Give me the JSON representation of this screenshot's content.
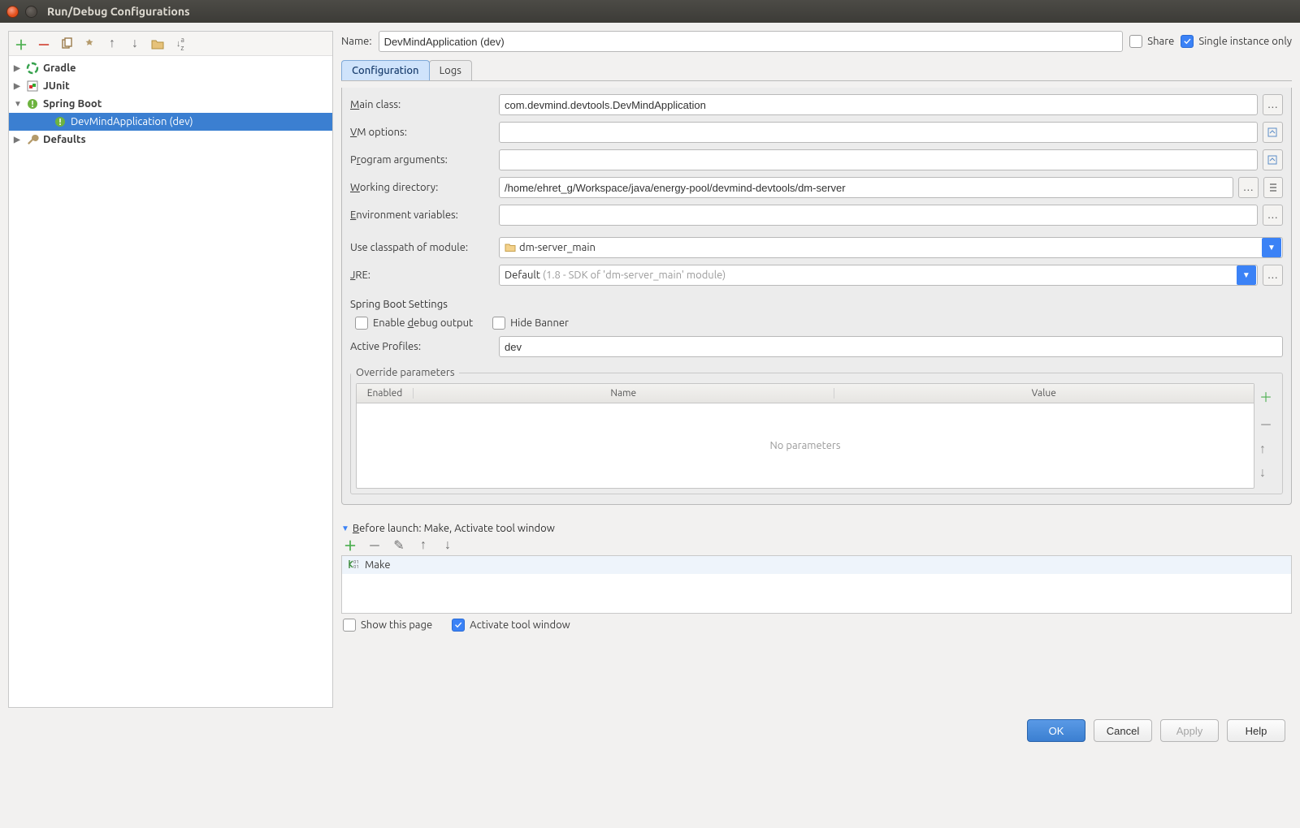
{
  "window": {
    "title": "Run/Debug Configurations"
  },
  "sidebar": {
    "toolbar": {
      "add": "+",
      "remove": "−",
      "copy": "⧉",
      "wrench": "⚙",
      "up": "↑",
      "down": "↓",
      "folder": "📁",
      "sort": "↓ᴬᶻ"
    },
    "nodes": {
      "gradle": "Gradle",
      "junit": "JUnit",
      "springboot": "Spring Boot",
      "springboot_child": "DevMindApplication (dev)",
      "defaults": "Defaults"
    }
  },
  "header": {
    "name_label": "Name:",
    "name_value": "DevMindApplication (dev)",
    "share_label": "Share",
    "single_instance_label": "Single instance only"
  },
  "tabs": {
    "configuration": "Configuration",
    "logs": "Logs"
  },
  "form": {
    "main_class": {
      "label": "Main class:",
      "value": "com.devmind.devtools.DevMindApplication"
    },
    "vm_options": {
      "label": "VM options:",
      "value": ""
    },
    "program_args": {
      "label": "Program arguments:",
      "value": ""
    },
    "working_dir": {
      "label": "Working directory:",
      "value": "/home/ehret_g/Workspace/java/energy-pool/devmind-devtools/dm-server"
    },
    "env_vars": {
      "label": "Environment variables:",
      "value": ""
    },
    "classpath": {
      "label": "Use classpath of module:",
      "value": "dm-server_main"
    },
    "jre": {
      "label": "JRE:",
      "prefix": "Default ",
      "suffix": "(1.8 - SDK of 'dm-server_main' module)"
    }
  },
  "spring": {
    "title": "Spring Boot Settings",
    "enable_debug": "Enable debug output",
    "hide_banner": "Hide Banner",
    "active_profiles_label": "Active Profiles:",
    "active_profiles_value": "dev",
    "override_title": "Override parameters",
    "th_enabled": "Enabled",
    "th_name": "Name",
    "th_value": "Value",
    "empty": "No parameters"
  },
  "before_launch": {
    "title": "Before launch: Make, Activate tool window",
    "item": "Make",
    "show_this_page": "Show this page",
    "activate_tool_window": "Activate tool window"
  },
  "buttons": {
    "ok": "OK",
    "cancel": "Cancel",
    "apply": "Apply",
    "help": "Help"
  }
}
